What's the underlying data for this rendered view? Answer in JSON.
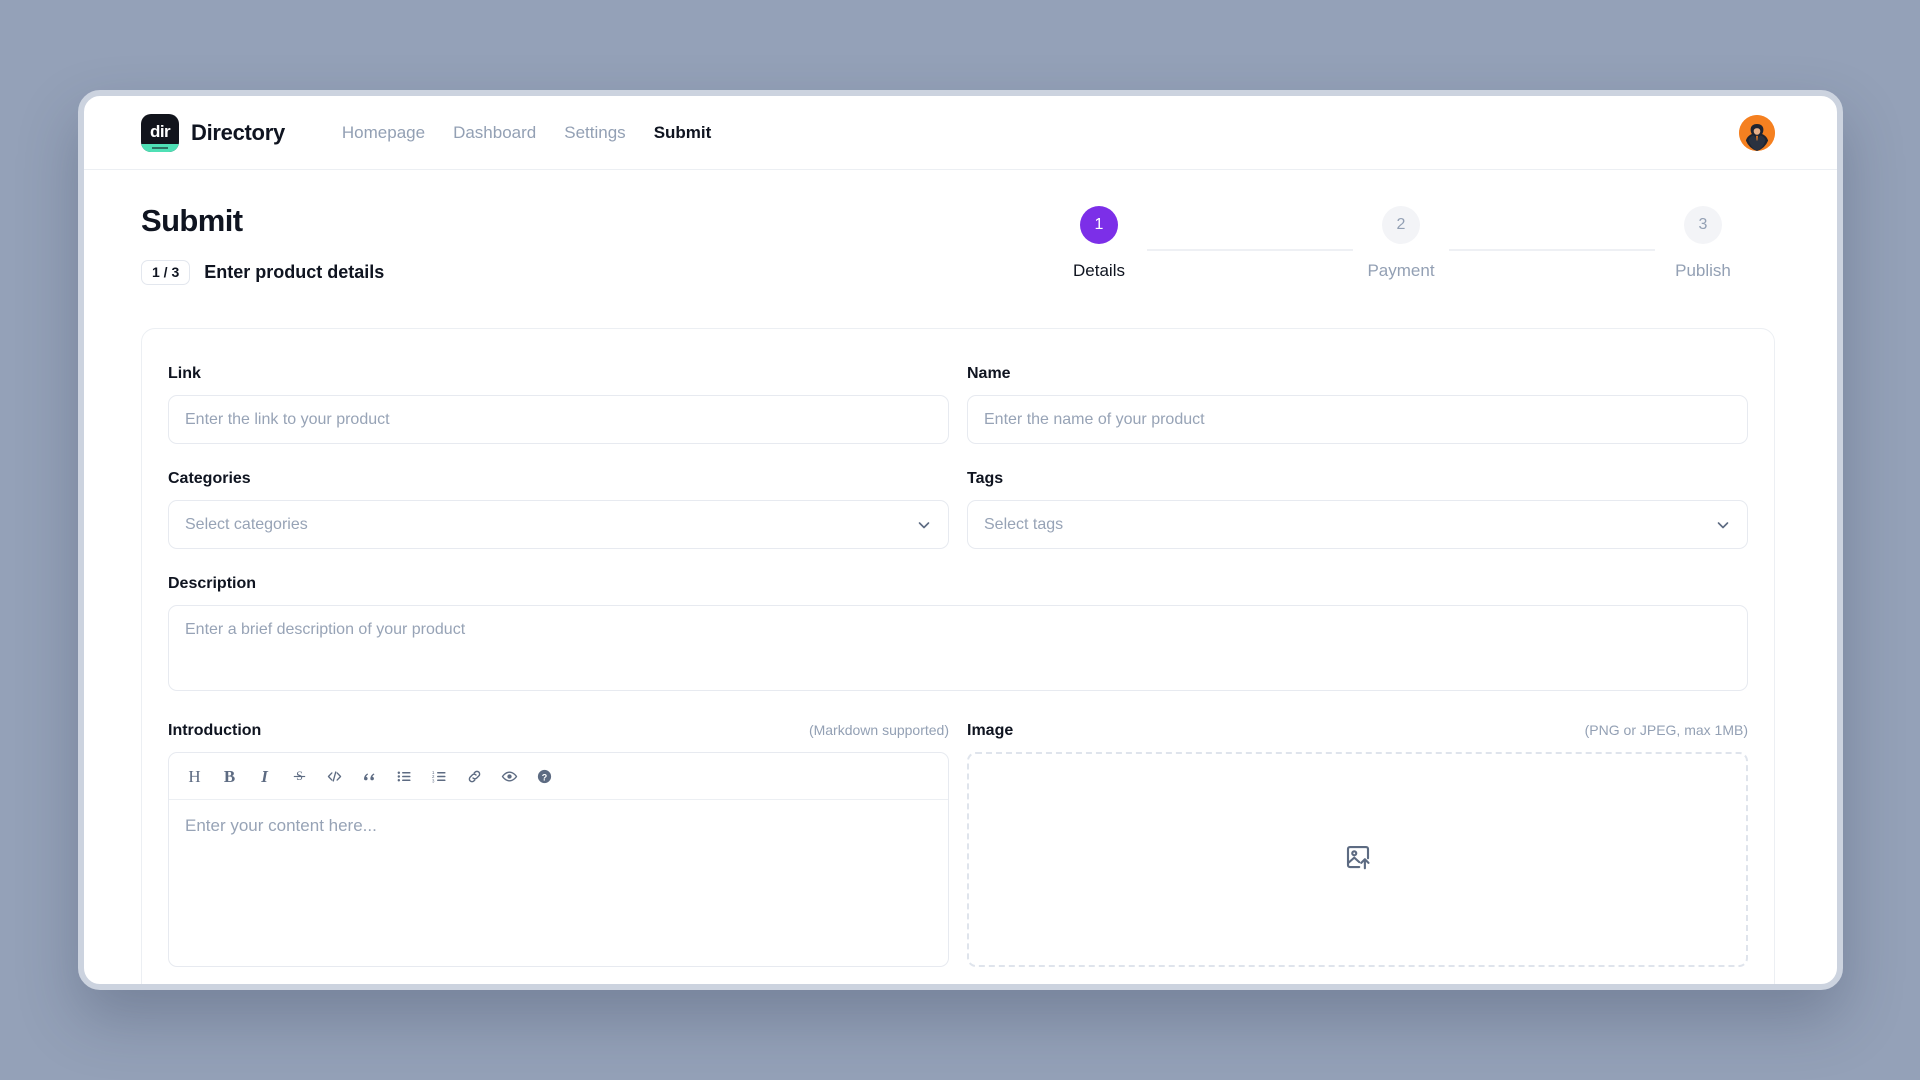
{
  "nav": {
    "brand_name": "Directory",
    "logo_text": "dir",
    "links": [
      {
        "label": "Homepage",
        "active": false
      },
      {
        "label": "Dashboard",
        "active": false
      },
      {
        "label": "Settings",
        "active": false
      },
      {
        "label": "Submit",
        "active": true
      }
    ]
  },
  "header": {
    "title": "Submit",
    "step_badge": "1 / 3",
    "subtitle": "Enter product details"
  },
  "stepper": {
    "active_color": "#7c2fe8",
    "steps": [
      {
        "number": "1",
        "label": "Details"
      },
      {
        "number": "2",
        "label": "Payment"
      },
      {
        "number": "3",
        "label": "Publish"
      }
    ]
  },
  "form": {
    "link": {
      "label": "Link",
      "placeholder": "Enter the link to your product",
      "value": ""
    },
    "name": {
      "label": "Name",
      "placeholder": "Enter the name of your product",
      "value": ""
    },
    "categories": {
      "label": "Categories",
      "placeholder": "Select categories",
      "value": ""
    },
    "tags": {
      "label": "Tags",
      "placeholder": "Select tags",
      "value": ""
    },
    "description": {
      "label": "Description",
      "placeholder": "Enter a brief description of your product",
      "value": ""
    },
    "introduction": {
      "label": "Introduction",
      "hint": "(Markdown supported)",
      "placeholder": "Enter your content here...",
      "value": "",
      "toolbar": [
        {
          "icon": "heading-icon",
          "glyph": "H"
        },
        {
          "icon": "bold-icon",
          "glyph": "B"
        },
        {
          "icon": "italic-icon",
          "glyph": "I"
        },
        {
          "icon": "strikethrough-icon",
          "glyph": "S"
        },
        {
          "icon": "code-icon",
          "glyph": "</>"
        },
        {
          "icon": "quote-icon",
          "glyph": "“"
        },
        {
          "icon": "bullet-list-icon",
          "glyph": ""
        },
        {
          "icon": "numbered-list-icon",
          "glyph": ""
        },
        {
          "icon": "link-icon",
          "glyph": ""
        },
        {
          "icon": "preview-eye-icon",
          "glyph": ""
        },
        {
          "icon": "help-icon",
          "glyph": "?"
        }
      ]
    },
    "image": {
      "label": "Image",
      "hint": "(PNG or JPEG, max 1MB)",
      "upload_icon": "image-upload-icon"
    }
  }
}
